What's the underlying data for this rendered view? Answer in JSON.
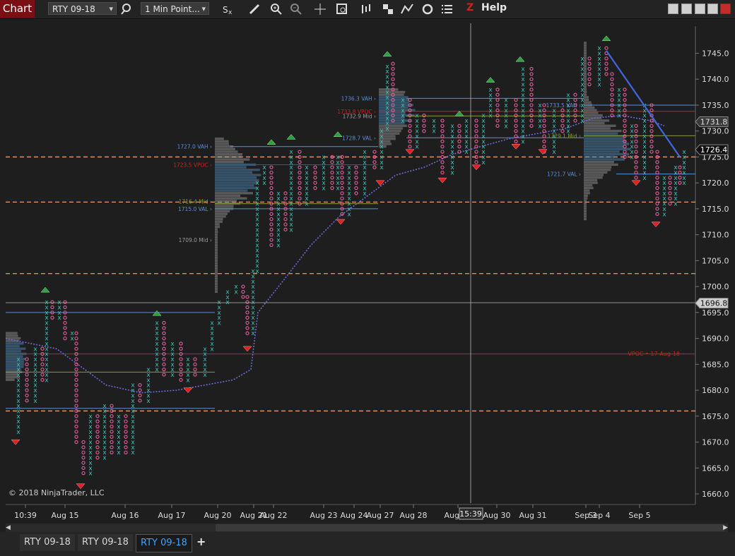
{
  "toolbar": {
    "chart_label": "Chart",
    "instrument": "RTY 09-18",
    "interval": "1 Min Point...",
    "help_label": "Help",
    "icons": [
      "search-icon",
      "strategy-icon",
      "pencil-icon",
      "zoom-in-icon",
      "zoom-out-icon",
      "crosshair-icon",
      "data-box-icon",
      "bar-type-icon",
      "properties-icon",
      "indicators-icon",
      "refresh-icon",
      "menu-icon",
      "z-icon"
    ]
  },
  "chart": {
    "copyright": "© 2018 NinjaTrader, LLC",
    "y_ticks": [
      "1745.0",
      "1740.0",
      "1735.0",
      "1730.0",
      "1725.0",
      "1720.0",
      "1715.0",
      "1710.0",
      "1705.0",
      "1700.0",
      "1695.0",
      "1690.0",
      "1685.0",
      "1680.0",
      "1675.0",
      "1670.0",
      "1665.0",
      "1660.0"
    ],
    "x_ticks": [
      "10:39",
      "Aug 15",
      "Aug 16",
      "Aug 17",
      "Aug 20",
      "Aug 21",
      "Aug 22",
      "Aug 23",
      "Aug 24",
      "Aug 27",
      "Aug 28",
      "Aug 29",
      "Aug 30",
      "Aug 31",
      "Sep 3",
      "Sep 4",
      "Sep 5"
    ],
    "crosshair_time": "15:39",
    "price_markers": [
      "1731.8",
      "1726.4",
      "1696.8"
    ],
    "profile_labels": [
      "1727.0 VAH",
      "1723.5 VPOC",
      "1715.0 VAL",
      "1709.0 Mid",
      "1736.3 VAH",
      "1733.8 VPOC",
      "1732.9 Mid",
      "1728.7 VAL",
      "1733.5 VAH",
      "1729.1 Mid",
      "1721.7 VAL",
      "1716.4 Mid"
    ],
    "naked_vpoc_label": "VPOC • 17-Aug-18",
    "colors": {
      "x": "#3fc1b4",
      "o": "#e0609a",
      "vah": "#5b8fd8",
      "vpoc": "#d02020",
      "trend": "#4466dd",
      "sma": "#6b6bd8",
      "dash": "#e89a70"
    }
  },
  "tabs": {
    "items": [
      "RTY 09-18",
      "RTY 09-18",
      "RTY 09-18"
    ],
    "active_index": 2,
    "add_label": "+"
  }
}
